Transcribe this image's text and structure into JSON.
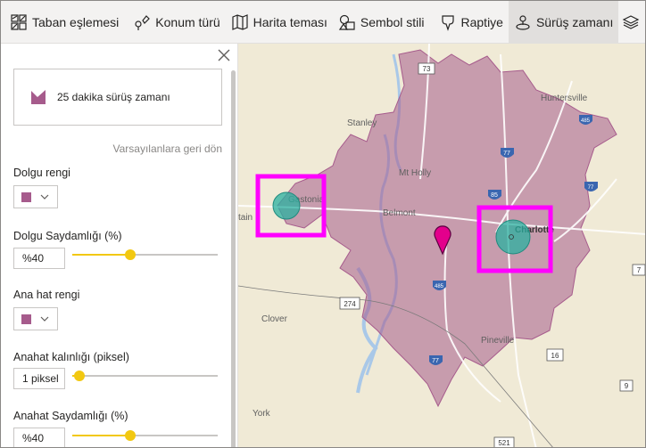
{
  "toolbar": {
    "items": [
      {
        "label": "Taban eşlemesi",
        "icon": "base-map-icon"
      },
      {
        "label": "Konum türü",
        "icon": "location-type-icon"
      },
      {
        "label": "Harita teması",
        "icon": "map-theme-icon"
      },
      {
        "label": "Sembol stili",
        "icon": "symbol-style-icon"
      },
      {
        "label": "Raptiye",
        "icon": "pin-icon"
      },
      {
        "label": "Sürüş zamanı",
        "icon": "drive-time-icon",
        "active": true
      },
      {
        "label": "",
        "icon": "layers-icon"
      }
    ]
  },
  "panel": {
    "preset_label": "25 dakika sürüş zamanı",
    "reset_link": "Varsayılanlara geri dön",
    "fill_color_label": "Dolgu rengi",
    "fill_color": "#a65b8c",
    "fill_opacity_label": "Dolgu Saydamlığı (%)",
    "fill_opacity_value": "%40",
    "fill_opacity_level": 0.4,
    "outline_color_label": "Ana hat rengi",
    "outline_color": "#a65b8c",
    "outline_width_label": "Anahat kalınlığı (piksel)",
    "outline_width_value": "1 piksel",
    "outline_width_level": 0.05,
    "outline_opacity_label": "Anahat Saydamlığı (%)",
    "outline_opacity_value": "%40",
    "outline_opacity_level": 0.4
  },
  "map": {
    "drive_time_color": "#a65b8c",
    "highlight_color": "#ff00ff",
    "bubble_color": "#2ab0a0",
    "pin_color": "#e3008c",
    "towns": {
      "huntersville": "Huntersville",
      "stanley": "Stanley",
      "mt_holly": "Mt Holly",
      "gastonia": "Gastonia",
      "belmont": "Belmont",
      "charlotte": "Charlotte",
      "clover": "Clover",
      "pineville": "Pineville",
      "york": "York",
      "tain": "tain"
    },
    "shields": {
      "r73": "73",
      "i77a": "77",
      "i77b": "77",
      "i85": "85",
      "i485": "485",
      "i485b": "485",
      "r274": "274",
      "r16": "16",
      "r521": "521",
      "i77c": "77",
      "r7": "7",
      "r9": "9"
    }
  }
}
